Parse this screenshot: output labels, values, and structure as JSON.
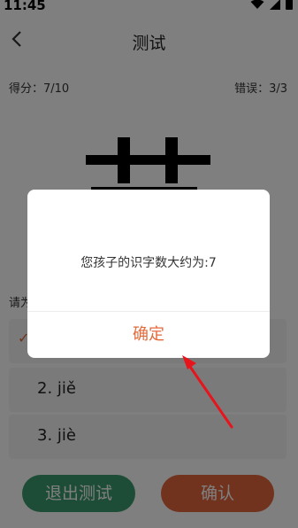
{
  "status": {
    "time": "11:45"
  },
  "header": {
    "title": "测试"
  },
  "stats": {
    "score": "得分：7/10",
    "errors": "错误：3/3"
  },
  "question": {
    "prompt": "请为"
  },
  "options": [
    {
      "label": "",
      "checked": true
    },
    {
      "label": "2. jiě"
    },
    {
      "label": "3. jiè"
    }
  ],
  "buttons": {
    "exit": "退出测试",
    "confirm": "确认"
  },
  "dialog": {
    "message": "您孩子的识字数大约为:7",
    "ok": "确定"
  },
  "colors": {
    "accent": "#e2673a",
    "green": "#3c9a6e",
    "arrow": "#e8141c"
  }
}
